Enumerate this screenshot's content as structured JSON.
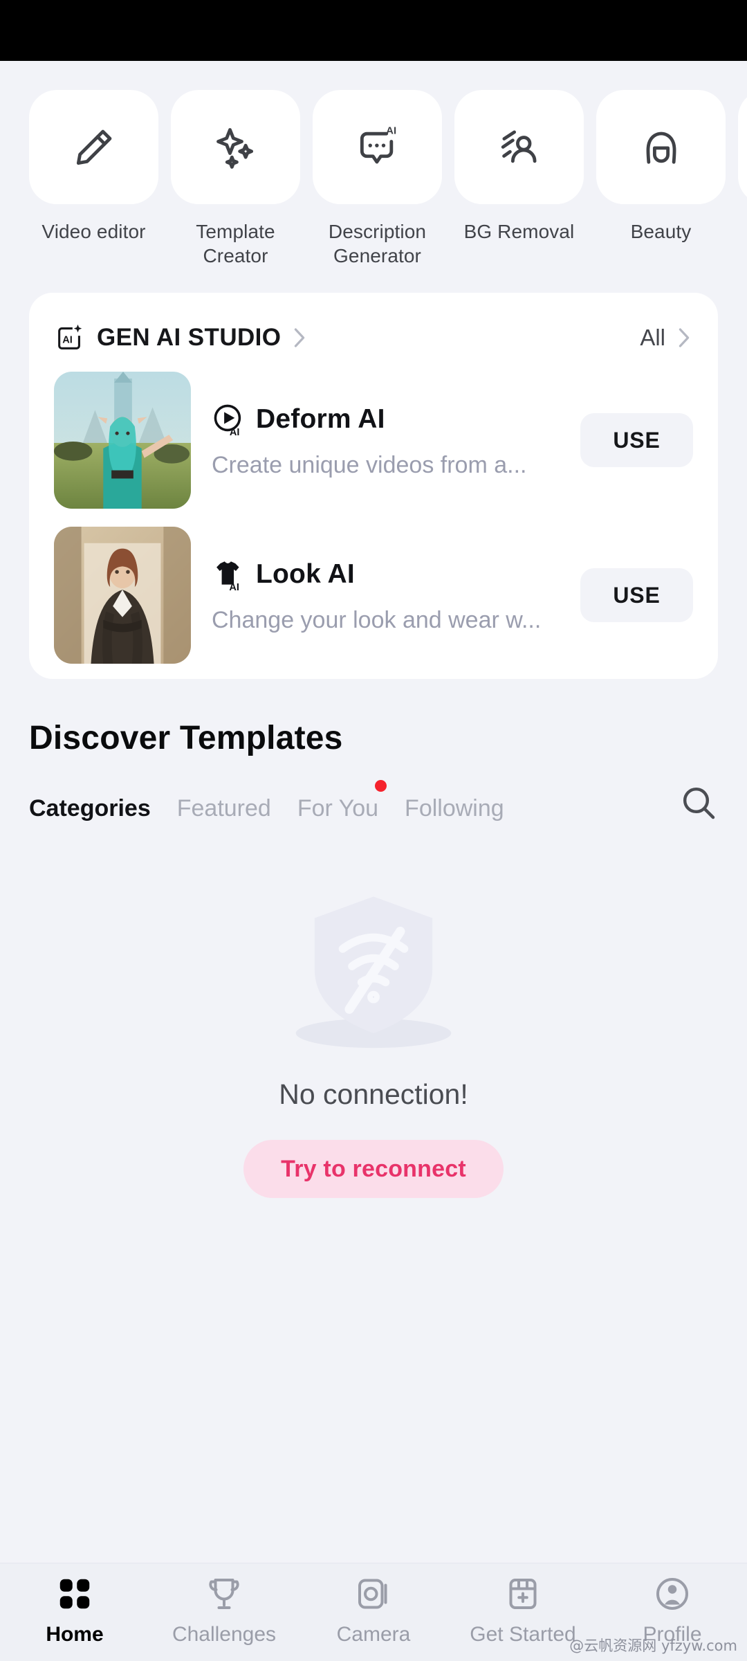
{
  "tools": [
    {
      "label": "Video editor",
      "icon": "pencil-icon"
    },
    {
      "label": "Template Creator",
      "icon": "sparkles-icon"
    },
    {
      "label": "Description Generator",
      "icon": "ai-chat-bubble-icon"
    },
    {
      "label": "BG Removal",
      "icon": "person-cutout-icon"
    },
    {
      "label": "Beauty",
      "icon": "face-beauty-icon"
    }
  ],
  "studio": {
    "title": "GEN AI STUDIO",
    "badge_icon": "ai-badge-icon",
    "title_chevron_icon": "chevron-right-icon",
    "all_label": "All",
    "all_chevron_icon": "chevron-right-icon",
    "items": [
      {
        "name": "Deform AI",
        "description": "Create unique videos from a...",
        "icon": "play-ai-icon",
        "action_label": "USE",
        "thumb_alt": "fantasy-elf-character-thumbnail"
      },
      {
        "name": "Look AI",
        "description": "Change your look and wear w...",
        "icon": "tshirt-ai-icon",
        "action_label": "USE",
        "thumb_alt": "woman-in-suit-thumbnail"
      }
    ]
  },
  "discover": {
    "title": "Discover Templates",
    "tabs": [
      {
        "label": "Categories",
        "active": true,
        "badge": false
      },
      {
        "label": "Featured",
        "active": false,
        "badge": false
      },
      {
        "label": "For You",
        "active": false,
        "badge": true
      },
      {
        "label": "Following",
        "active": false,
        "badge": false
      }
    ],
    "search_icon": "search-icon"
  },
  "empty_state": {
    "illustration": "shield-no-wifi-icon",
    "message": "No connection!",
    "button_label": "Try to reconnect"
  },
  "bottom_nav": [
    {
      "label": "Home",
      "icon": "grid-icon",
      "active": true
    },
    {
      "label": "Challenges",
      "icon": "trophy-icon",
      "active": false
    },
    {
      "label": "Camera",
      "icon": "camera-icon",
      "active": false
    },
    {
      "label": "Get Started",
      "icon": "calendar-plus-icon",
      "active": false
    },
    {
      "label": "Profile",
      "icon": "person-circle-icon",
      "active": false
    }
  ],
  "watermark": "@云帆资源网 yfzyw.com",
  "colors": {
    "background": "#f2f3f8",
    "card": "#ffffff",
    "accent_pink": "#e8336a",
    "accent_pink_bg": "#fbddea",
    "badge_red": "#f5222d",
    "text_primary": "#111216",
    "text_muted": "#9a9dae"
  }
}
